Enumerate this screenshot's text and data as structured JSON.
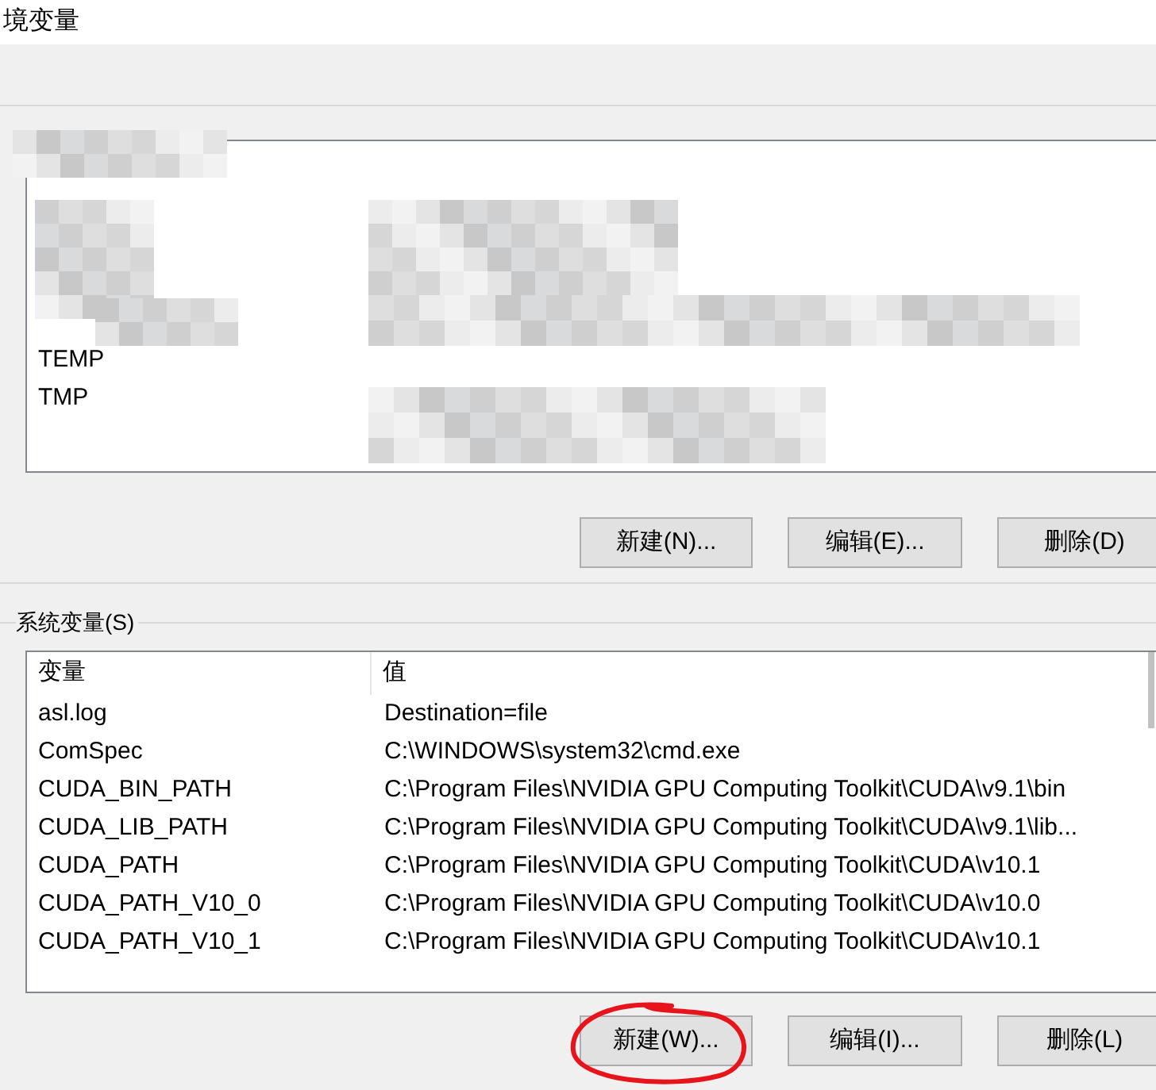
{
  "window": {
    "title": "境变量"
  },
  "user_variables": {
    "rows": [
      {
        "name": "TEMP"
      },
      {
        "name": "TMP"
      }
    ],
    "buttons": [
      {
        "label": "新建(N)...",
        "circled": false
      },
      {
        "label": "编辑(E)...",
        "circled": false
      },
      {
        "label": "删除(D)",
        "circled": false
      }
    ]
  },
  "system_variables": {
    "label": "系统变量(S)",
    "columns": [
      "变量",
      "值"
    ],
    "rows": [
      {
        "name": "asl.log",
        "value": "Destination=file"
      },
      {
        "name": "ComSpec",
        "value": "C:\\WINDOWS\\system32\\cmd.exe"
      },
      {
        "name": "CUDA_BIN_PATH",
        "value": "C:\\Program Files\\NVIDIA GPU Computing Toolkit\\CUDA\\v9.1\\bin"
      },
      {
        "name": "CUDA_LIB_PATH",
        "value": "C:\\Program Files\\NVIDIA GPU Computing Toolkit\\CUDA\\v9.1\\lib..."
      },
      {
        "name": "CUDA_PATH",
        "value": "C:\\Program Files\\NVIDIA GPU Computing Toolkit\\CUDA\\v10.1"
      },
      {
        "name": "CUDA_PATH_V10_0",
        "value": "C:\\Program Files\\NVIDIA GPU Computing Toolkit\\CUDA\\v10.0"
      },
      {
        "name": "CUDA_PATH_V10_1",
        "value": "C:\\Program Files\\NVIDIA GPU Computing Toolkit\\CUDA\\v10.1"
      }
    ],
    "buttons": [
      {
        "label": "新建(W)...",
        "circled": true
      },
      {
        "label": "编辑(I)...",
        "circled": false
      },
      {
        "label": "删除(L)",
        "circled": false
      }
    ]
  }
}
